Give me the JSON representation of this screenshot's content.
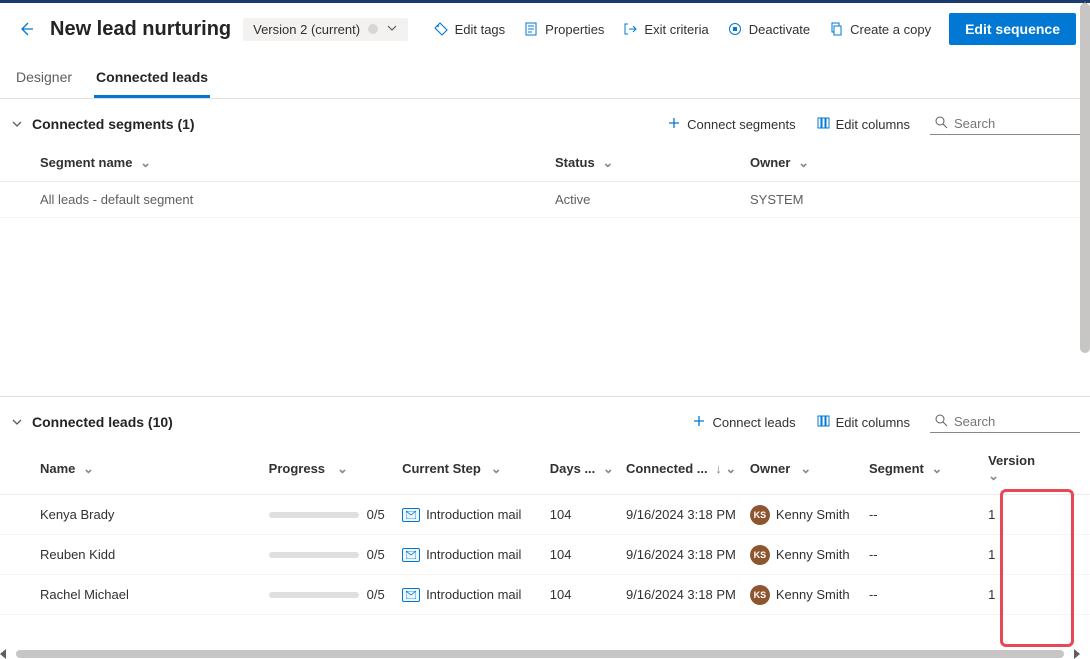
{
  "header": {
    "title": "New lead nurturing",
    "version_label": "Version 2 (current)",
    "actions": {
      "edit_tags": "Edit tags",
      "properties": "Properties",
      "exit_criteria": "Exit criteria",
      "deactivate": "Deactivate",
      "create_copy": "Create a copy",
      "primary": "Edit sequence"
    }
  },
  "tabs": {
    "designer": "Designer",
    "connected_leads": "Connected leads"
  },
  "segments": {
    "title": "Connected segments (1)",
    "connect_label": "Connect segments",
    "edit_columns": "Edit columns",
    "search_placeholder": "Search",
    "columns": {
      "name": "Segment name",
      "status": "Status",
      "owner": "Owner"
    },
    "rows": [
      {
        "name": "All leads - default segment",
        "status": "Active",
        "owner": "SYSTEM"
      }
    ]
  },
  "leads": {
    "title": "Connected leads (10)",
    "connect_label": "Connect leads",
    "edit_columns": "Edit columns",
    "search_placeholder": "Search",
    "columns": {
      "name": "Name",
      "progress": "Progress",
      "step": "Current Step",
      "days": "Days ...",
      "connected": "Connected ...",
      "owner": "Owner",
      "segment": "Segment",
      "version": "Version"
    },
    "rows": [
      {
        "name": "Kenya Brady",
        "progress": "0/5",
        "step": "Introduction mail",
        "days": "104",
        "connected": "9/16/2024 3:18 PM",
        "owner": "Kenny Smith",
        "initials": "KS",
        "segment": "--",
        "version": "1"
      },
      {
        "name": "Reuben Kidd",
        "progress": "0/5",
        "step": "Introduction mail",
        "days": "104",
        "connected": "9/16/2024 3:18 PM",
        "owner": "Kenny Smith",
        "initials": "KS",
        "segment": "--",
        "version": "1"
      },
      {
        "name": "Rachel Michael",
        "progress": "0/5",
        "step": "Introduction mail",
        "days": "104",
        "connected": "9/16/2024 3:18 PM",
        "owner": "Kenny Smith",
        "initials": "KS",
        "segment": "--",
        "version": "1"
      }
    ]
  }
}
